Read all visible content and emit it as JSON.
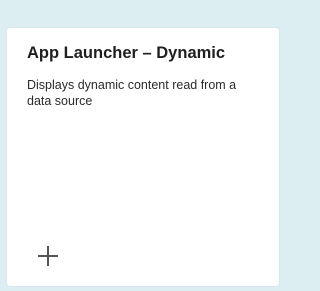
{
  "tile": {
    "title": "App Launcher – Dynamic",
    "description": "Displays dynamic content read from a data source",
    "add_icon": "plus-icon"
  },
  "colors": {
    "background": "#ddeef3",
    "card": "#ffffff",
    "title": "#1f1f1f",
    "icon": "#555555"
  }
}
